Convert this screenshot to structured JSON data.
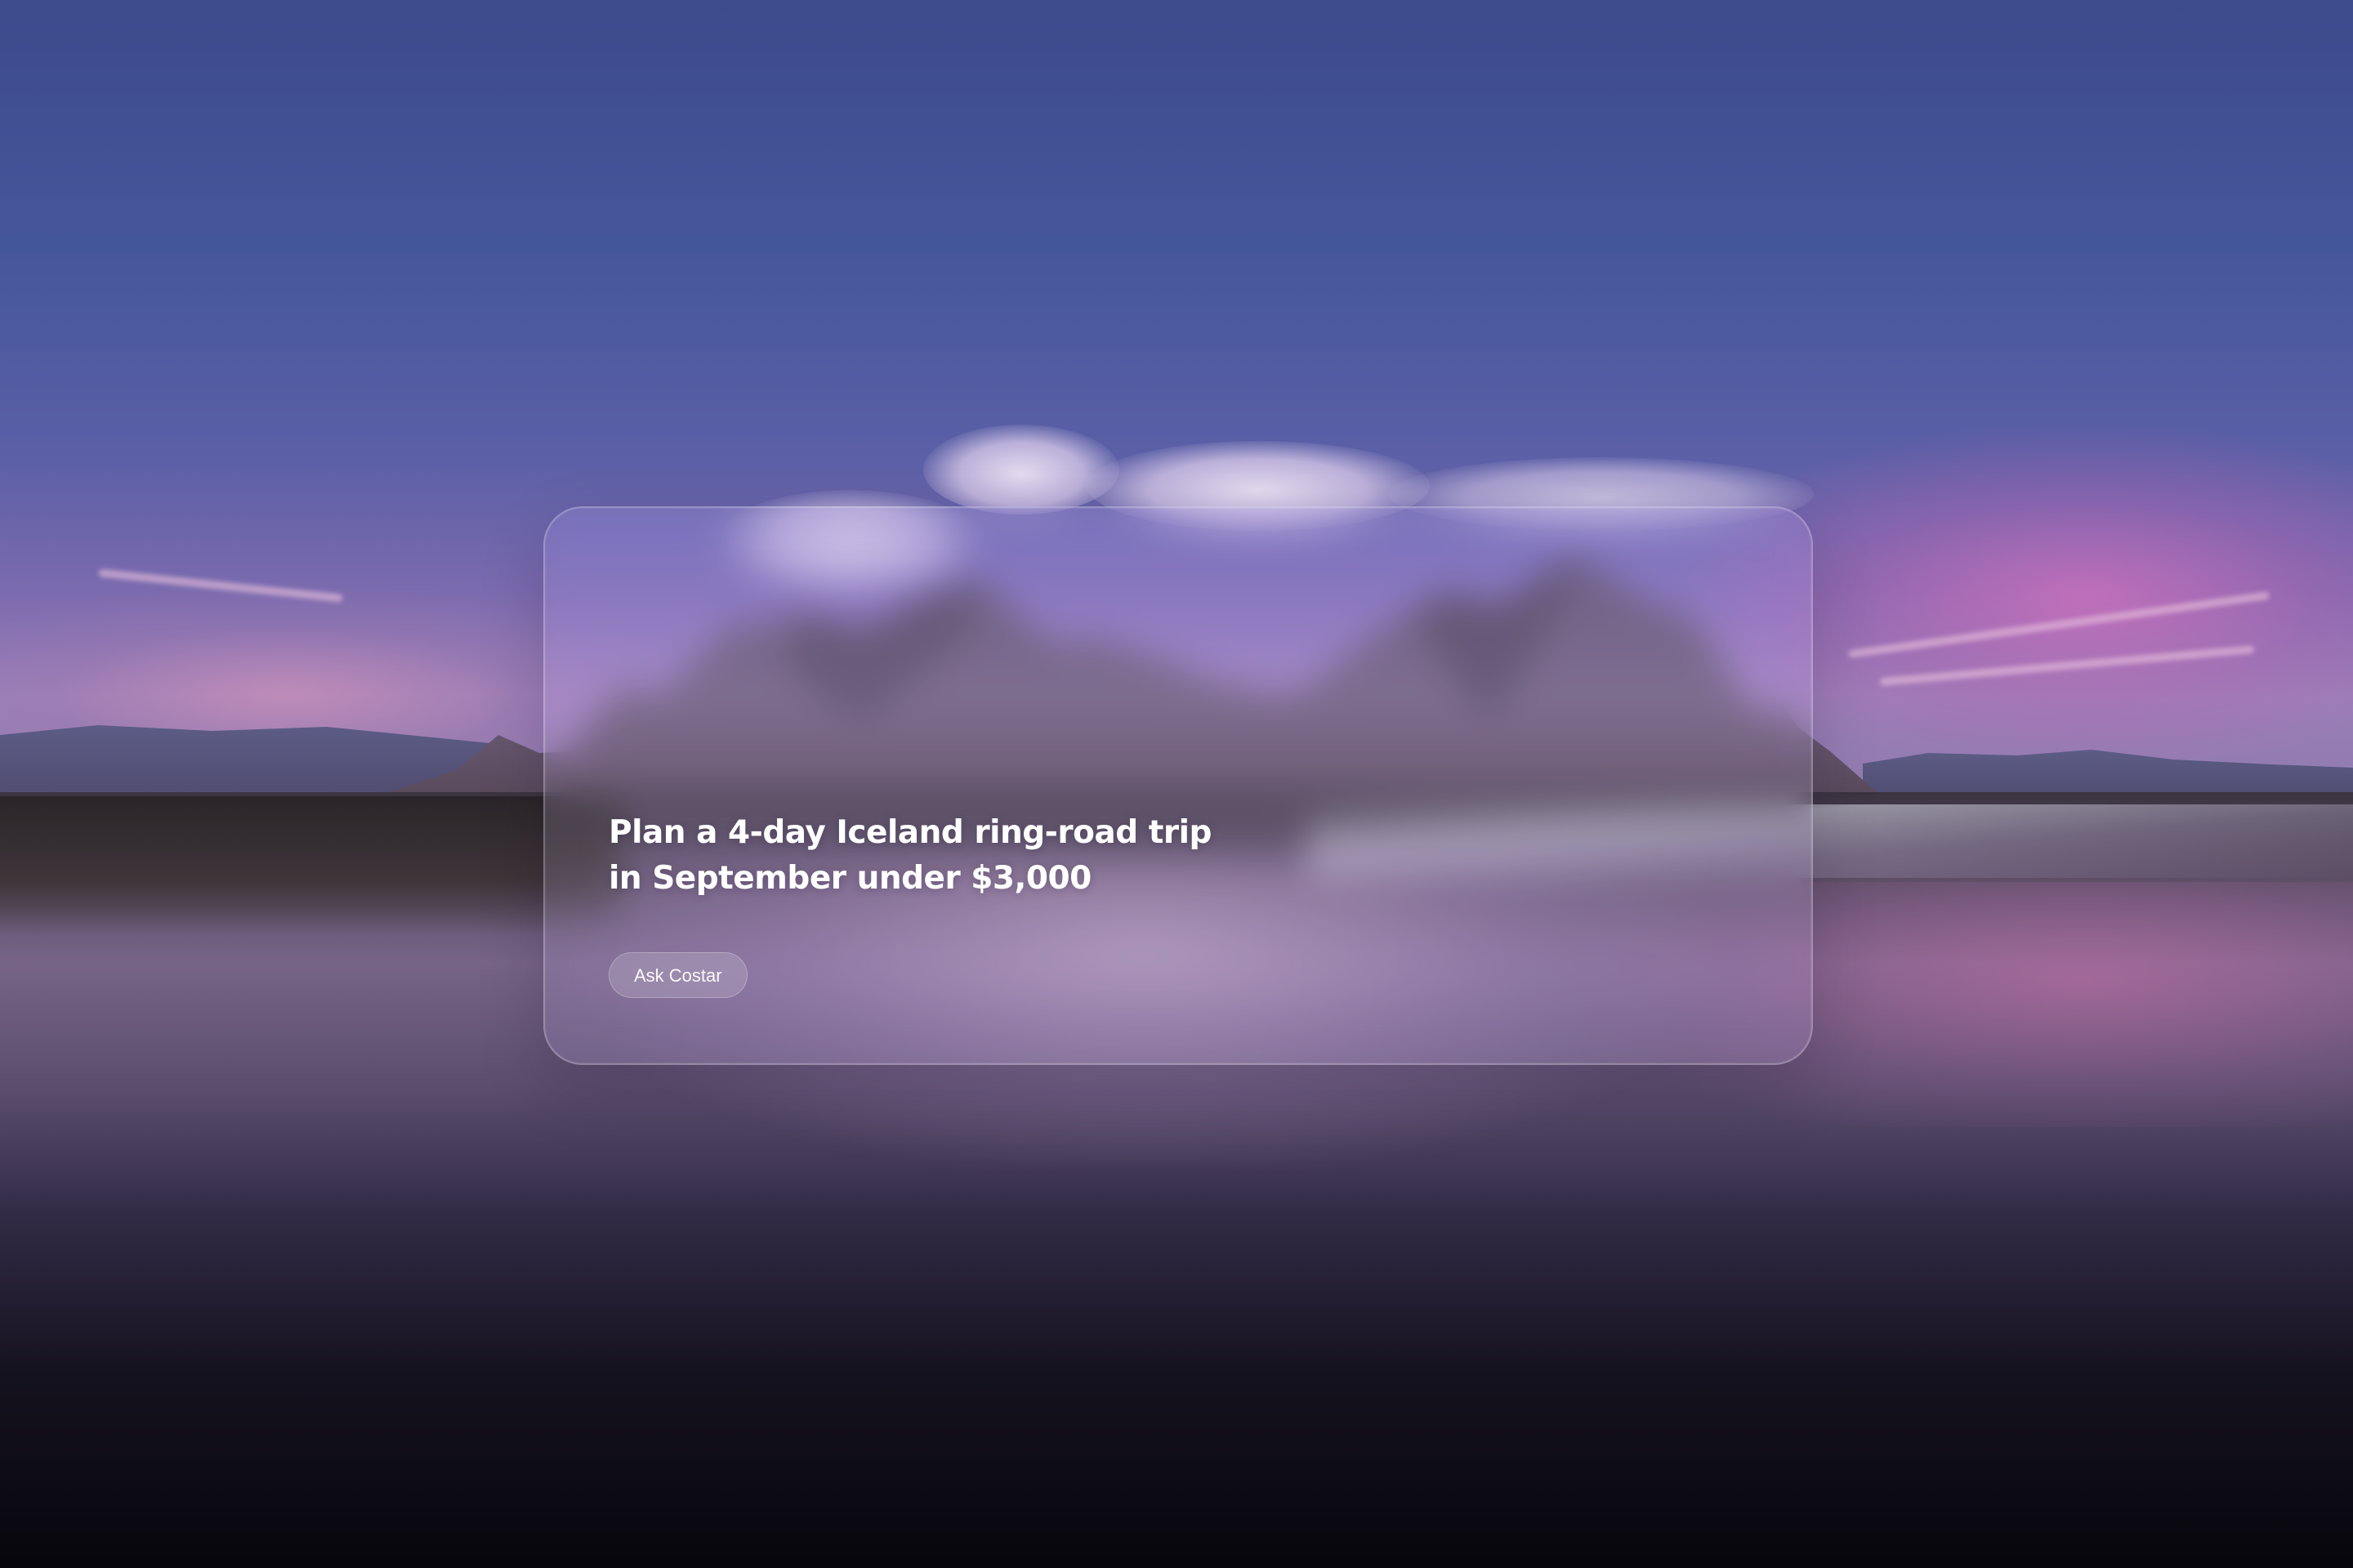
{
  "card": {
    "title_line1": "Plan a 4-day Iceland ring-road trip",
    "title_line2": "in September under $3,000",
    "button_label": "Ask Costar"
  },
  "colors": {
    "sky_top": "#3d4a8c",
    "sky_glow_pink": "#d670be",
    "ground_dark": "#07060c",
    "text": "#ffffff"
  }
}
